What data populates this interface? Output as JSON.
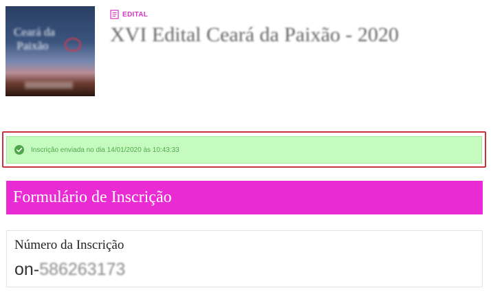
{
  "header": {
    "kind_label": "EDITAL",
    "title": "XVI Edital Ceará da Paixão - 2020",
    "thumbnail_icon": "event-poster-image"
  },
  "status_banner": {
    "message": "Inscrição enviada no dia 14/01/2020 às 10:43:33",
    "icon": "check-circle-icon",
    "background": "#c6fbc0",
    "highlight_border": "#c9323a"
  },
  "form": {
    "section_title": "Formulário de Inscrição",
    "accent_color": "#ea2bd3",
    "registration": {
      "label": "Número da Inscrição",
      "prefix": "on-",
      "number": "586263173"
    }
  }
}
